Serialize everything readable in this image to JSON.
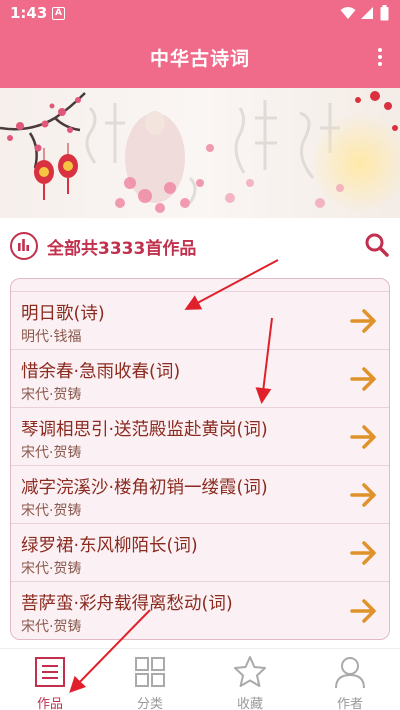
{
  "status_bar": {
    "time": "1:43",
    "notification_icon": "A"
  },
  "app_bar": {
    "title": "中华古诗词"
  },
  "summary": {
    "text": "全部共3333首作品"
  },
  "poems": [
    {
      "title": "明日歌(诗)",
      "author": "明代·钱福"
    },
    {
      "title": "惜余春·急雨收春(词)",
      "author": "宋代·贺铸"
    },
    {
      "title": "琴调相思引·送范殿监赴黄岗(词)",
      "author": "宋代·贺铸"
    },
    {
      "title": "减字浣溪沙·楼角初销一缕霞(词)",
      "author": "宋代·贺铸"
    },
    {
      "title": "绿罗裙·东风柳陌长(词)",
      "author": "宋代·贺铸"
    },
    {
      "title": "菩萨蛮·彩舟载得离愁动(词)",
      "author": "宋代·贺铸"
    }
  ],
  "bottom_nav": {
    "items": [
      {
        "label": "作品",
        "icon": "document-list-icon",
        "active": true
      },
      {
        "label": "分类",
        "icon": "grid-icon",
        "active": false
      },
      {
        "label": "收藏",
        "icon": "star-icon",
        "active": false
      },
      {
        "label": "作者",
        "icon": "person-icon",
        "active": false
      }
    ]
  },
  "colors": {
    "primary": "#f06b8a",
    "accent": "#c1304d",
    "list_background": "#fbf1f4",
    "title_text": "#8b2a1f",
    "arrow": "#e0922a"
  }
}
